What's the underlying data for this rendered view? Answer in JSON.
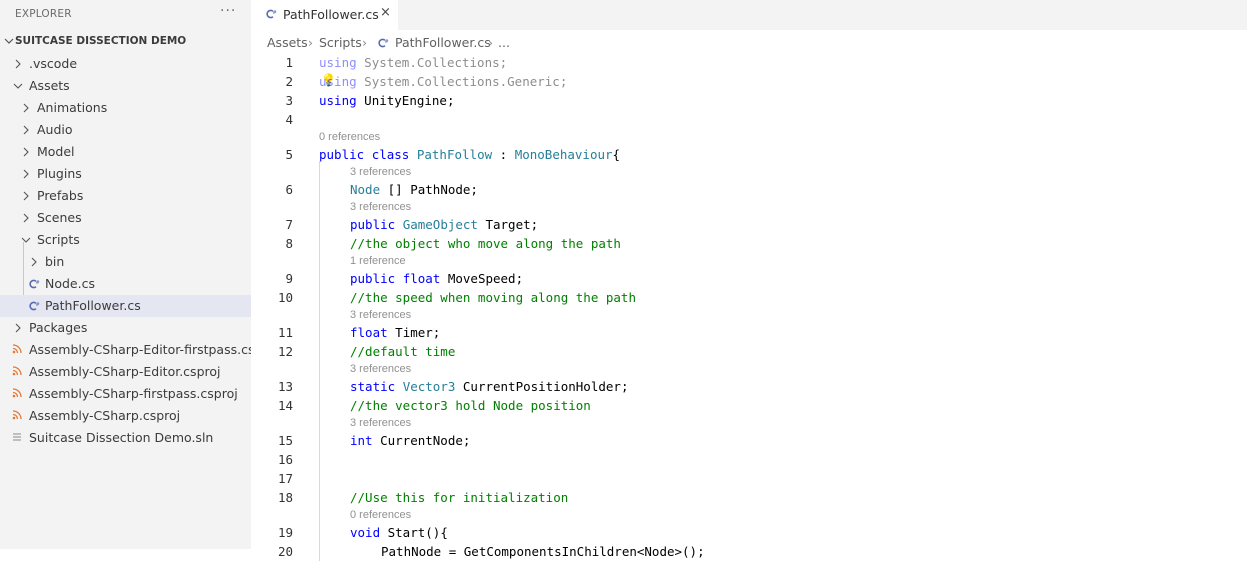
{
  "explorer": {
    "title": "EXPLORER",
    "more": "···",
    "project": "SUITCASE DISSECTION DEMO",
    "items": [
      {
        "label": ".vscode"
      },
      {
        "label": "Assets"
      },
      {
        "label": "Animations"
      },
      {
        "label": "Audio"
      },
      {
        "label": "Model"
      },
      {
        "label": "Plugins"
      },
      {
        "label": "Prefabs"
      },
      {
        "label": "Scenes"
      },
      {
        "label": "Scripts"
      },
      {
        "label": "bin"
      },
      {
        "label": "Node.cs"
      },
      {
        "label": "PathFollower.cs"
      },
      {
        "label": "Packages"
      },
      {
        "label": "Assembly-CSharp-Editor-firstpass.cs..."
      },
      {
        "label": "Assembly-CSharp-Editor.csproj"
      },
      {
        "label": "Assembly-CSharp-firstpass.csproj"
      },
      {
        "label": "Assembly-CSharp.csproj"
      },
      {
        "label": "Suitcase Dissection Demo.sln"
      }
    ]
  },
  "tab": {
    "label": "PathFollower.cs",
    "close": "×"
  },
  "breadcrumb": {
    "parts": [
      "Assets",
      "Scripts",
      "PathFollower.cs",
      "..."
    ],
    "sep": "›"
  },
  "editor": {
    "line_numbers": [
      "1",
      "2",
      "3",
      "4",
      "5",
      "6",
      "7",
      "8",
      "9",
      "10",
      "11",
      "12",
      "13",
      "14",
      "15",
      "16",
      "17",
      "18",
      "19",
      "20"
    ],
    "lenses": [
      "0 references",
      "3 references",
      "3 references",
      "1 reference",
      "3 references",
      "3 references",
      "3 references",
      "0 references"
    ],
    "tokens": {
      "using": "using",
      "ns1": " System.Collections;",
      "ns2": " System.Collections.Generic;",
      "ns3": " UnityEngine;",
      "public": "public",
      "class": "class",
      "classname": "PathFollow",
      "colon": " : ",
      "base": "MonoBehaviour",
      "brace": "{",
      "node": "Node",
      "arr": " [] PathNode;",
      "go": "GameObject",
      "target": " Target;",
      "c8": "//the object who move along the path",
      "float": "float",
      "movespeed": " MoveSpeed;",
      "c10": "//the speed when moving along the path",
      "timer": " Timer;",
      "c12": "//default time",
      "static": "static",
      "vector3": "Vector3",
      "cph": " CurrentPositionHolder;",
      "c14": "//the vector3 hold Node position",
      "int": "int",
      "cnode": " CurrentNode;",
      "c18": "//Use this for initialization",
      "void": "void",
      "start": " Start(){",
      "line20": "PathNode = GetComponentsInChildren<Node>();"
    }
  },
  "colors": {
    "keyword": "#0000ff",
    "type": "#267f99",
    "comment": "#008000",
    "csharp_icon": "#5a6ab0",
    "xml_icon": "#e37933"
  }
}
